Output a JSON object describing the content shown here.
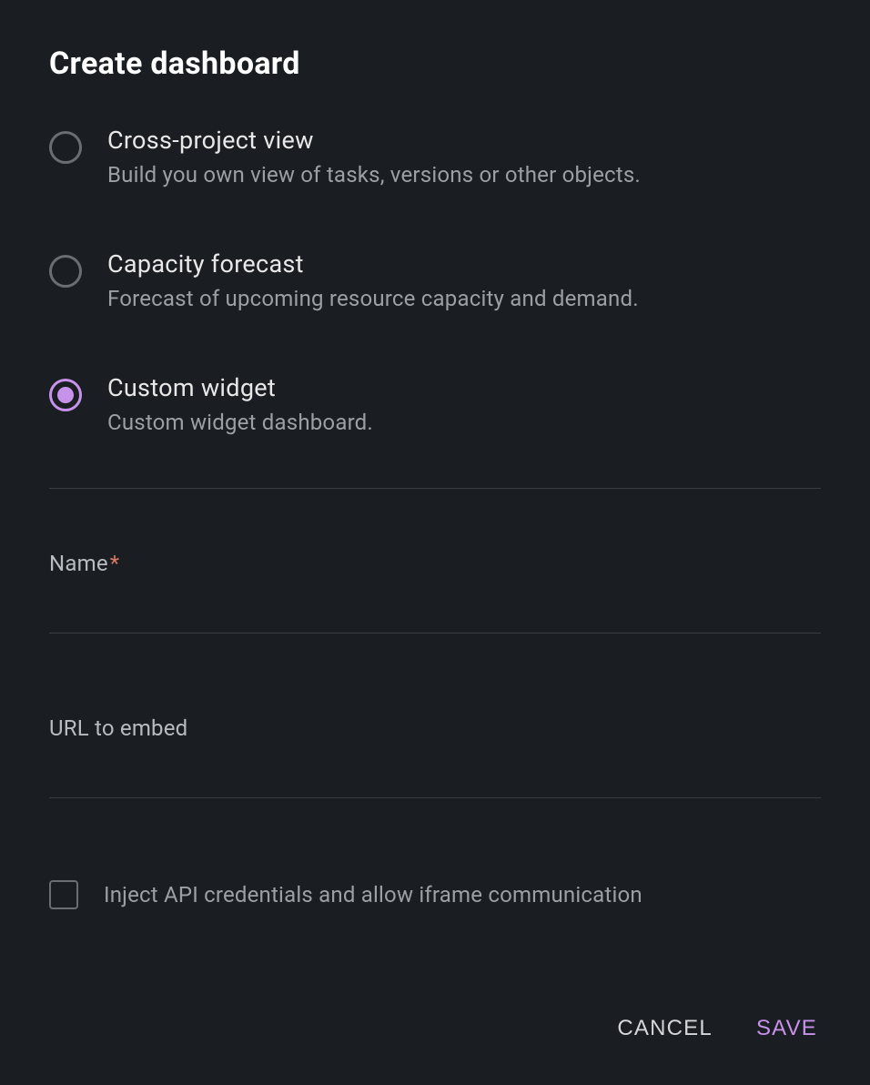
{
  "dialog": {
    "title": "Create dashboard"
  },
  "options": [
    {
      "title": "Cross-project view",
      "desc": "Build you own view of tasks, versions or other objects.",
      "selected": false
    },
    {
      "title": "Capacity forecast",
      "desc": "Forecast of upcoming resource capacity and demand.",
      "selected": false
    },
    {
      "title": "Custom widget",
      "desc": "Custom widget dashboard.",
      "selected": true
    }
  ],
  "fields": {
    "name": {
      "label": "Name",
      "required_mark": "*",
      "value": ""
    },
    "url": {
      "label": "URL to embed",
      "value": ""
    }
  },
  "checkbox": {
    "label": "Inject API credentials and allow iframe communication",
    "checked": false
  },
  "buttons": {
    "cancel": "CANCEL",
    "save": "SAVE"
  }
}
